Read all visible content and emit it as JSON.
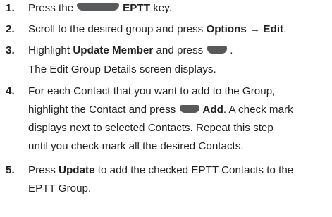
{
  "steps": [
    {
      "number": "1.",
      "pre": "Press the",
      "key_name": "EPTT",
      "post": " key."
    },
    {
      "number": "2.",
      "pre": "Scroll to the desired group and press ",
      "bold": "Options → Edit",
      "post": "."
    },
    {
      "number": "3.",
      "pre": "Highlight ",
      "bold": "Update Member",
      "post": " and press",
      "post2": ".",
      "line2": "The Edit Group Details screen displays."
    },
    {
      "number": "4.",
      "line1": "For each Contact that you want to add to the Group,",
      "line2_pre": "highlight the Contact and press",
      "line2_bold": "Add",
      "line2_post": ". A check mark",
      "line3": "displays next to selected Contacts. Repeat this step",
      "line4": "until you check mark all the desired Contacts."
    },
    {
      "number": "5.",
      "pre": "Press ",
      "bold": "Update",
      "post": " to add the checked EPTT Contacts to the",
      "line2": "EPTT Group."
    }
  ]
}
